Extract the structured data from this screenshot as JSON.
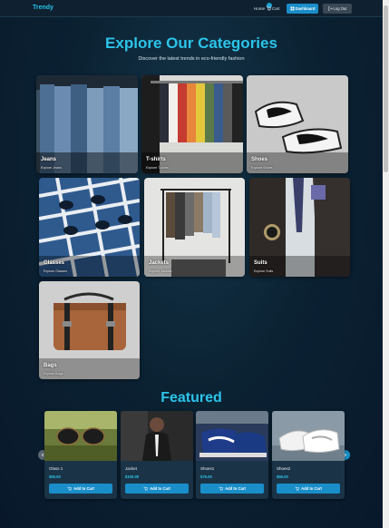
{
  "navbar": {
    "brand": "Trendy",
    "home_label": "Home",
    "cart_label": "Cart",
    "cart_count": "",
    "dashboard_label": "Dashboard",
    "logout_label": "Log Out"
  },
  "hero": {
    "title": "Explore Our Categories",
    "subtitle": "Discover the latest trends in eco-friendly fashion"
  },
  "categories": [
    {
      "name": "Jeans",
      "link": "Explore Jeans",
      "icon": "jeans-photo"
    },
    {
      "name": "T-shirts",
      "link": "Explore T-shirts",
      "icon": "tshirts-photo"
    },
    {
      "name": "Shoes",
      "link": "Explore Shoes",
      "icon": "shoes-photo"
    },
    {
      "name": "Glasses",
      "link": "Explore Glasses",
      "icon": "glasses-photo"
    },
    {
      "name": "Jackets",
      "link": "Explore Jackets",
      "icon": "jackets-photo"
    },
    {
      "name": "Suits",
      "link": "Explore Suits",
      "icon": "suits-photo"
    },
    {
      "name": "Bags",
      "link": "Explore Bags",
      "icon": "bags-photo"
    }
  ],
  "featured": {
    "title": "Featured",
    "products": [
      {
        "name": "Glass 1",
        "price": "$50.00",
        "button": "Add to Cart"
      },
      {
        "name": "Jacket",
        "price": "$100.00",
        "button": "Add to Cart"
      },
      {
        "name": "Shoes1",
        "price": "$75.00",
        "button": "Add to Cart"
      },
      {
        "name": "Shoes2",
        "price": "$66.00",
        "button": "Add to Cart"
      }
    ]
  },
  "colors": {
    "accent": "#2cc4ea",
    "button": "#1a8ec9",
    "navbar": "#0f2130",
    "background": "#0b2233"
  }
}
